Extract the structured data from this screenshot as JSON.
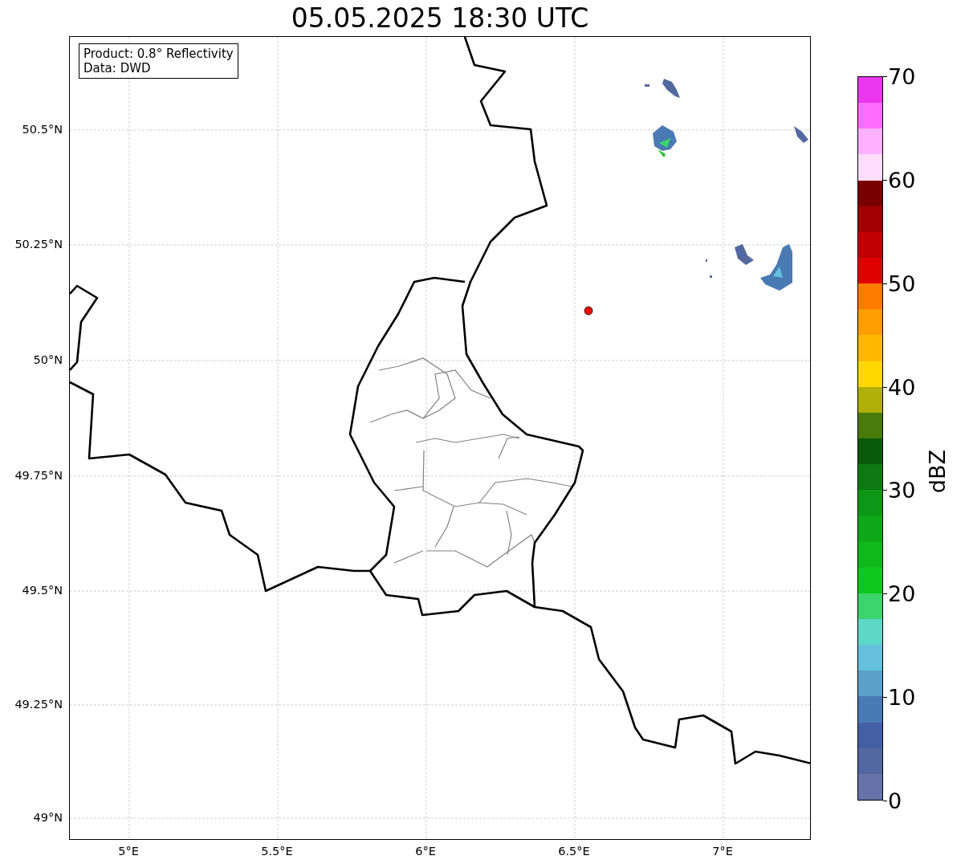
{
  "title": "05.05.2025 18:30 UTC",
  "info_box": {
    "lines": [
      "Product: 0.8° Reflectivity",
      "Data: DWD"
    ]
  },
  "x_ticks": [
    "5°E",
    "5.5°E",
    "6°E",
    "6.5°E",
    "7°E"
  ],
  "y_ticks": [
    "50.5°N",
    "50.25°N",
    "50°N",
    "49.75°N",
    "49.5°N",
    "49.25°N",
    "49°N"
  ],
  "colorbar": {
    "label": "dBZ",
    "ticks": [
      "70",
      "60",
      "50",
      "40",
      "30",
      "20",
      "10",
      "0"
    ],
    "bins": [
      {
        "color": "#ea36ee"
      },
      {
        "color": "#ff6cff"
      },
      {
        "color": "#ffb0ff"
      },
      {
        "color": "#ffddff"
      },
      {
        "color": "#7a0000"
      },
      {
        "color": "#a00000"
      },
      {
        "color": "#c00000"
      },
      {
        "color": "#e00000"
      },
      {
        "color": "#ff7c00"
      },
      {
        "color": "#ff9c00"
      },
      {
        "color": "#ffb800"
      },
      {
        "color": "#ffd800"
      },
      {
        "color": "#b0b008"
      },
      {
        "color": "#4a7a0a"
      },
      {
        "color": "#075a0a"
      },
      {
        "color": "#0c7a10"
      },
      {
        "color": "#0c9816"
      },
      {
        "color": "#0ea818"
      },
      {
        "color": "#10b81a"
      },
      {
        "color": "#10c81c"
      },
      {
        "color": "#3cd46c"
      },
      {
        "color": "#5ed8c6"
      },
      {
        "color": "#64c0dc"
      },
      {
        "color": "#5aa0c8"
      },
      {
        "color": "#4a7ab4"
      },
      {
        "color": "#4460a4"
      },
      {
        "color": "#5468a0"
      },
      {
        "color": "#6573a8"
      }
    ]
  }
}
